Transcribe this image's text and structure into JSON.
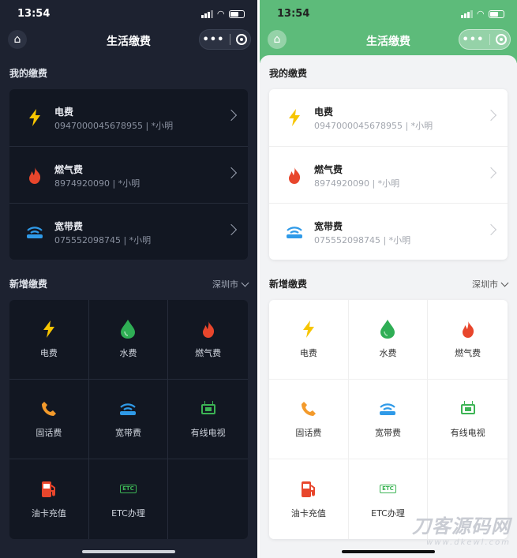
{
  "status": {
    "time": "13:54"
  },
  "nav": {
    "title": "生活缴费"
  },
  "my_bills": {
    "title": "我的缴费",
    "items": [
      {
        "name": "电费",
        "detail": "0947000045678955 | *小明",
        "icon": "lightning-icon",
        "color": "#f7c500"
      },
      {
        "name": "燃气费",
        "detail": "8974920090 | *小明",
        "icon": "flame-icon",
        "color": "#e8462c"
      },
      {
        "name": "宽带费",
        "detail": "075552098745 | *小明",
        "icon": "wifi-icon",
        "color": "#2f9ae8"
      }
    ]
  },
  "new_bills": {
    "title": "新增缴费",
    "city": "深圳市",
    "items": [
      {
        "label": "电费",
        "icon": "lightning-icon"
      },
      {
        "label": "水费",
        "icon": "water-drop-icon"
      },
      {
        "label": "燃气费",
        "icon": "flame-icon"
      },
      {
        "label": "固话费",
        "icon": "phone-icon"
      },
      {
        "label": "宽带费",
        "icon": "wifi-icon"
      },
      {
        "label": "有线电视",
        "icon": "tv-icon"
      },
      {
        "label": "油卡充值",
        "icon": "fuel-icon"
      },
      {
        "label": "ETC办理",
        "icon": "etc-icon"
      },
      {
        "label": "",
        "icon": ""
      }
    ]
  },
  "icons": {
    "etc_text": "ETC"
  },
  "watermark": {
    "big": "刀客源码网",
    "small": "www.dkewl.com"
  }
}
